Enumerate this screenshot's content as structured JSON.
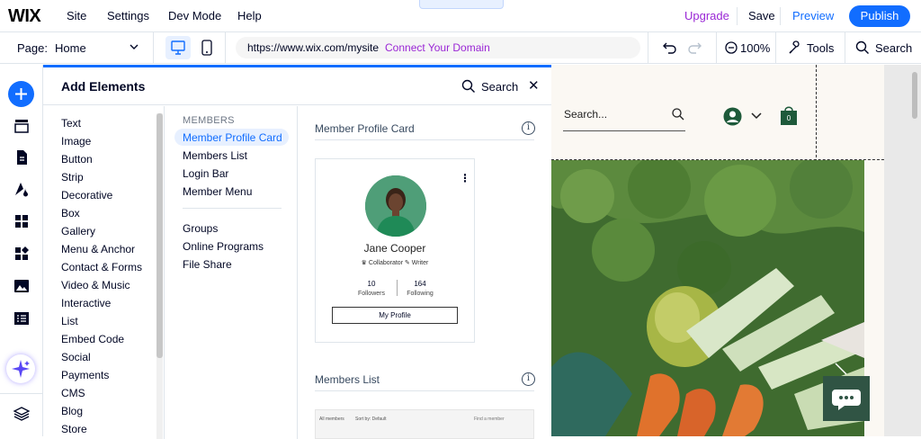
{
  "topbar": {
    "logo": "WIX",
    "menu": [
      "Site",
      "Settings",
      "Dev Mode",
      "Help"
    ],
    "upgrade": "Upgrade",
    "save": "Save",
    "preview": "Preview",
    "publish": "Publish"
  },
  "secbar": {
    "page_label": "Page:",
    "page_value": "Home",
    "url": "https://www.wix.com/mysite",
    "connect": "Connect Your Domain",
    "zoom": "100%",
    "tools": "Tools",
    "search": "Search"
  },
  "panel": {
    "title": "Add Elements",
    "search": "Search",
    "categories": [
      "Text",
      "Image",
      "Button",
      "Strip",
      "Decorative",
      "Box",
      "Gallery",
      "Menu & Anchor",
      "Contact & Forms",
      "Video & Music",
      "Interactive",
      "List",
      "Embed Code",
      "Social",
      "Payments",
      "CMS",
      "Blog",
      "Store"
    ],
    "sub_heading": "MEMBERS",
    "sub_items_a": [
      "Member Profile Card",
      "Members List",
      "Login Bar",
      "Member Menu"
    ],
    "sub_items_b": [
      "Groups",
      "Online Programs",
      "File Share"
    ],
    "section1_title": "Member Profile Card",
    "section2_title": "Members List",
    "card": {
      "name": "Jane Cooper",
      "roles": "♛ Collaborator   ✎ Writer",
      "followers_num": "10",
      "followers_lbl": "Followers",
      "following_num": "164",
      "following_lbl": "Following",
      "button": "My Profile"
    },
    "list_preview": {
      "all_members": "All members",
      "sort": "Sort by: Default",
      "find": "Find a member"
    }
  },
  "canvas": {
    "search_placeholder": "Search...",
    "cart_count": "0"
  },
  "colors": {
    "accent": "#116dff",
    "upgrade": "#9a27d5",
    "chat": "#305444"
  }
}
